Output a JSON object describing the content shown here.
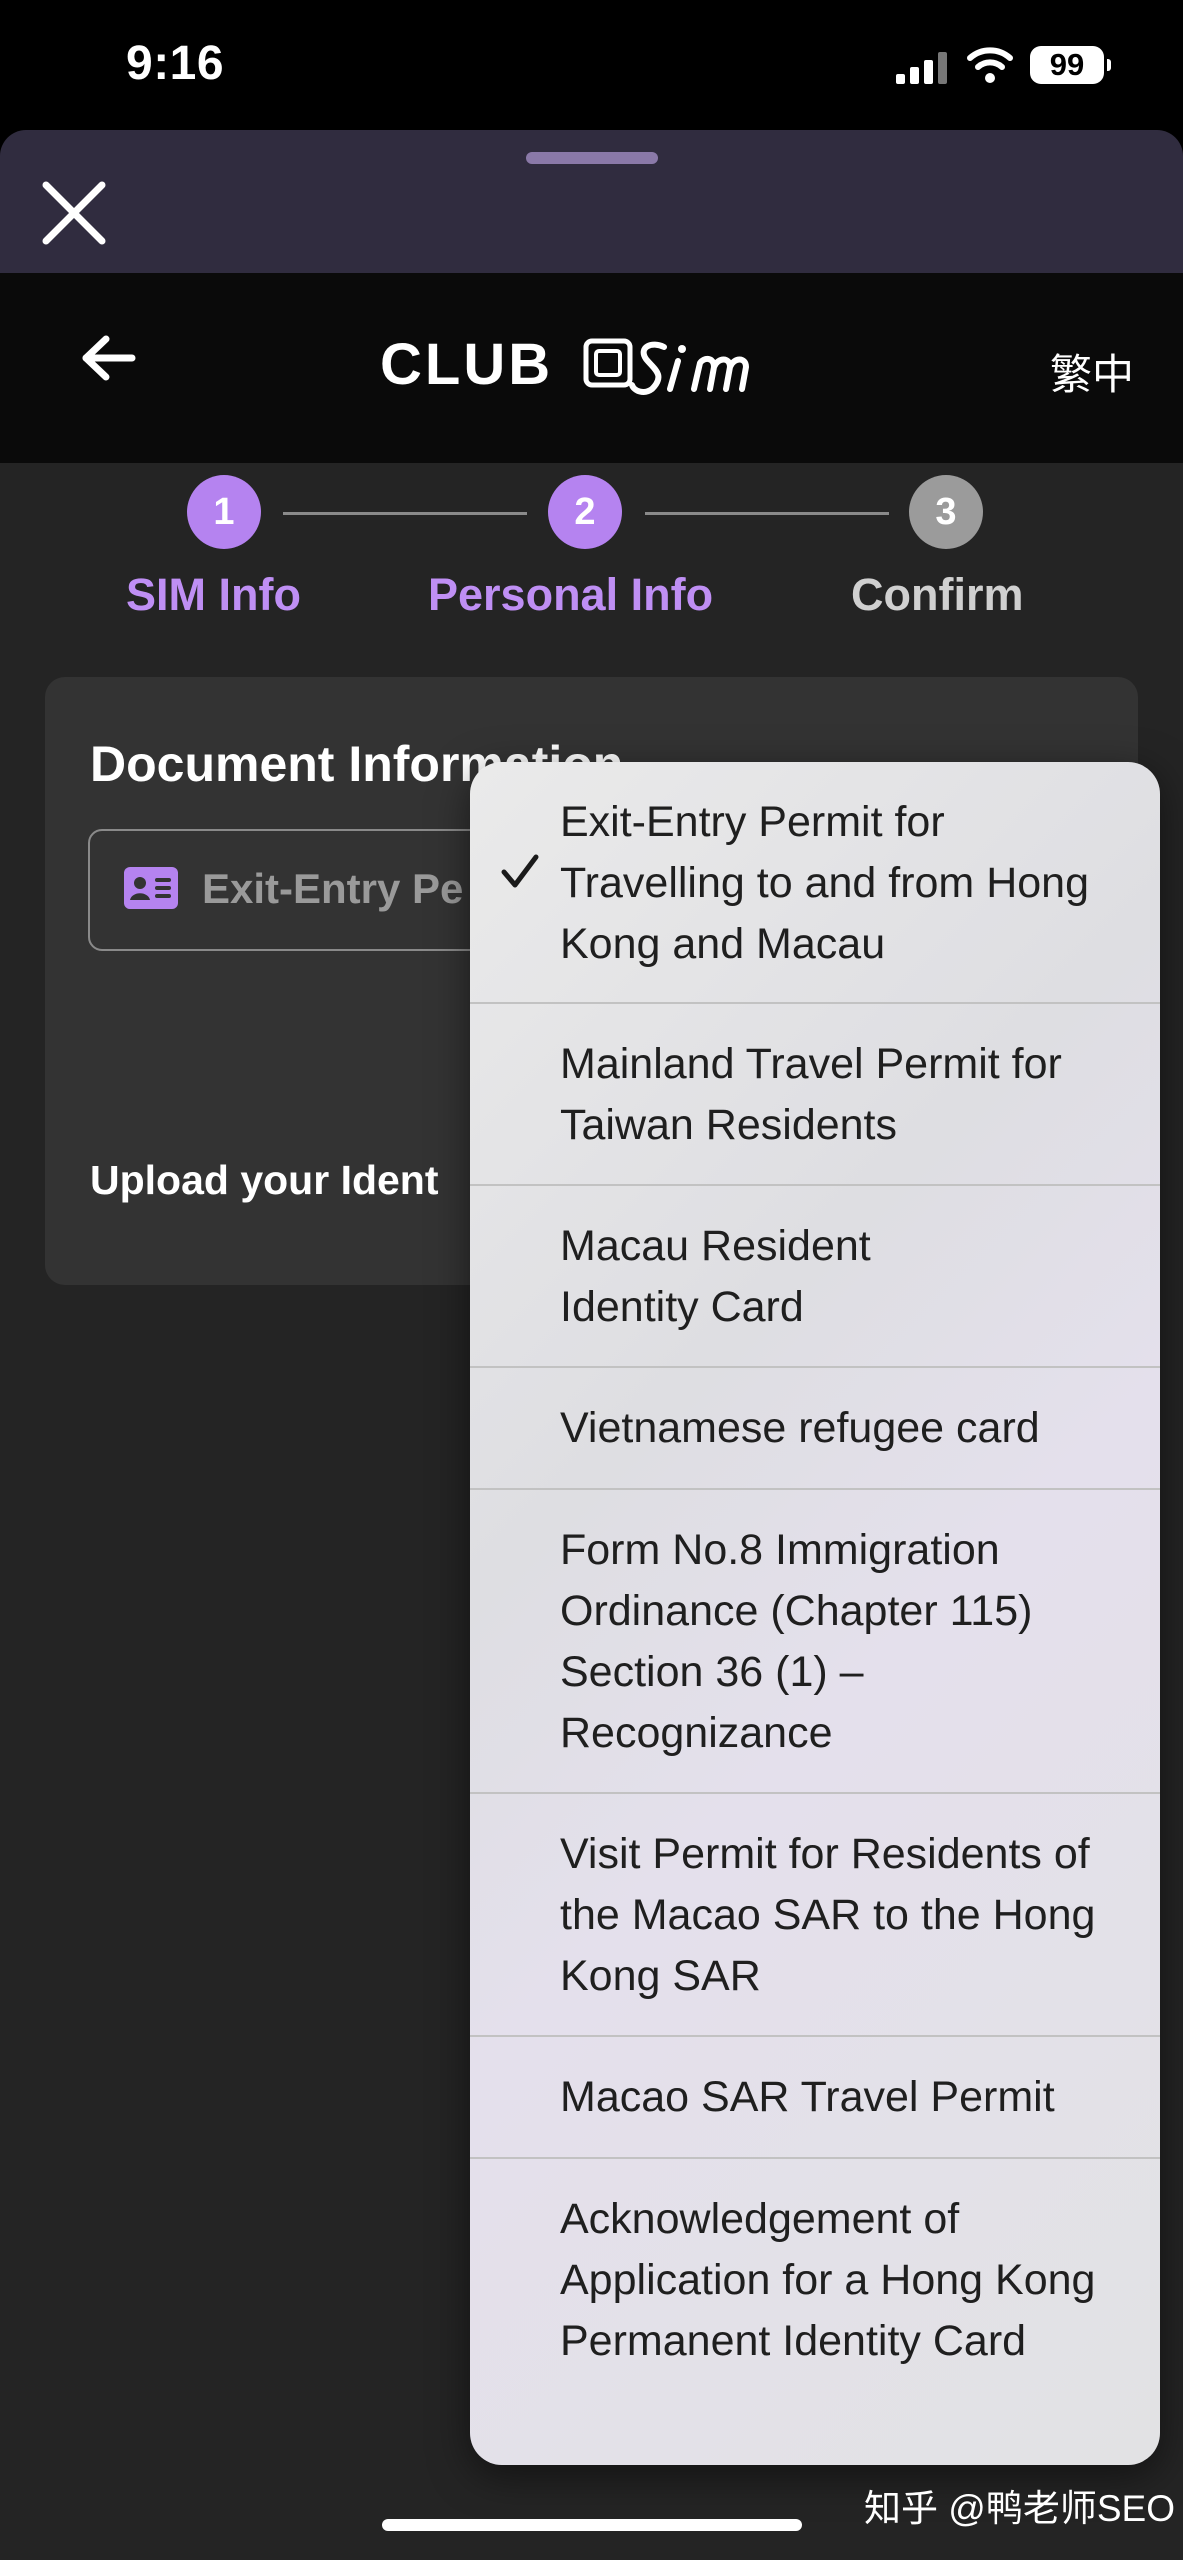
{
  "status": {
    "time": "9:16",
    "battery": "99"
  },
  "header": {
    "logo": "CLUB",
    "language": "繁中"
  },
  "steps": [
    {
      "num": "1",
      "label": "SIM Info"
    },
    {
      "num": "2",
      "label": "Personal Info"
    },
    {
      "num": "3",
      "label": "Confirm"
    }
  ],
  "form": {
    "title": "Document Information",
    "document_value": "Exit-Entry Pe",
    "upload_label": "Upload your Ident"
  },
  "menu": {
    "items": [
      {
        "label": "Exit-Entry Permit for Travelling to and from Hong Kong and Macau",
        "selected": true
      },
      {
        "label": "Mainland Travel Permit for Taiwan Residents"
      },
      {
        "label": "Macau Resident Identity Card"
      },
      {
        "label": "Vietnamese refugee card"
      },
      {
        "label": "Form No.8 Immigration Ordinance (Chapter 115) Section 36 (1) – Recognizance"
      },
      {
        "label": "Visit Permit for Residents of the Macao SAR to the Hong Kong SAR"
      },
      {
        "label": "Macao SAR Travel Permit"
      },
      {
        "label": "Acknowledgement of Application for a Hong Kong Permanent Identity Card"
      }
    ]
  },
  "watermark": "知乎 @鸭老师SEO"
}
